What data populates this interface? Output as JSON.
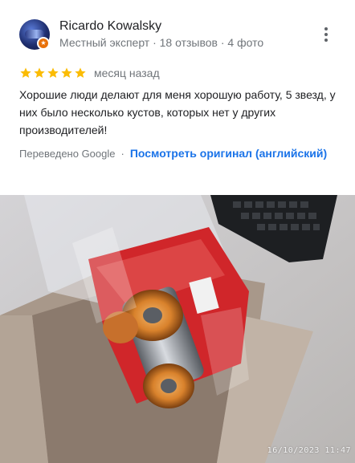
{
  "reviewer": {
    "name": "Ricardo Kowalsky",
    "meta": "Местный эксперт · 18 отзывов · 4 фото"
  },
  "rating": {
    "stars": 5,
    "time": "месяц назад"
  },
  "review": {
    "text": "Хорошие люди делают для меня хорошую работу, 5 звезд, у них было несколько кустов, которых нет у других производителей!"
  },
  "translation": {
    "label": "Переведено Google",
    "separator": "·",
    "link": "Посмотреть оригинал (английский)"
  },
  "photo": {
    "timestamp": "16/10/2023  11:47"
  },
  "colors": {
    "star": "#fbbc04",
    "link": "#1a73e8",
    "secondary_text": "#70757a",
    "badge": "#e8710a"
  },
  "icons": {
    "more": "more-vert-icon",
    "badge": "local-guide-badge-icon",
    "star": "star-icon"
  }
}
